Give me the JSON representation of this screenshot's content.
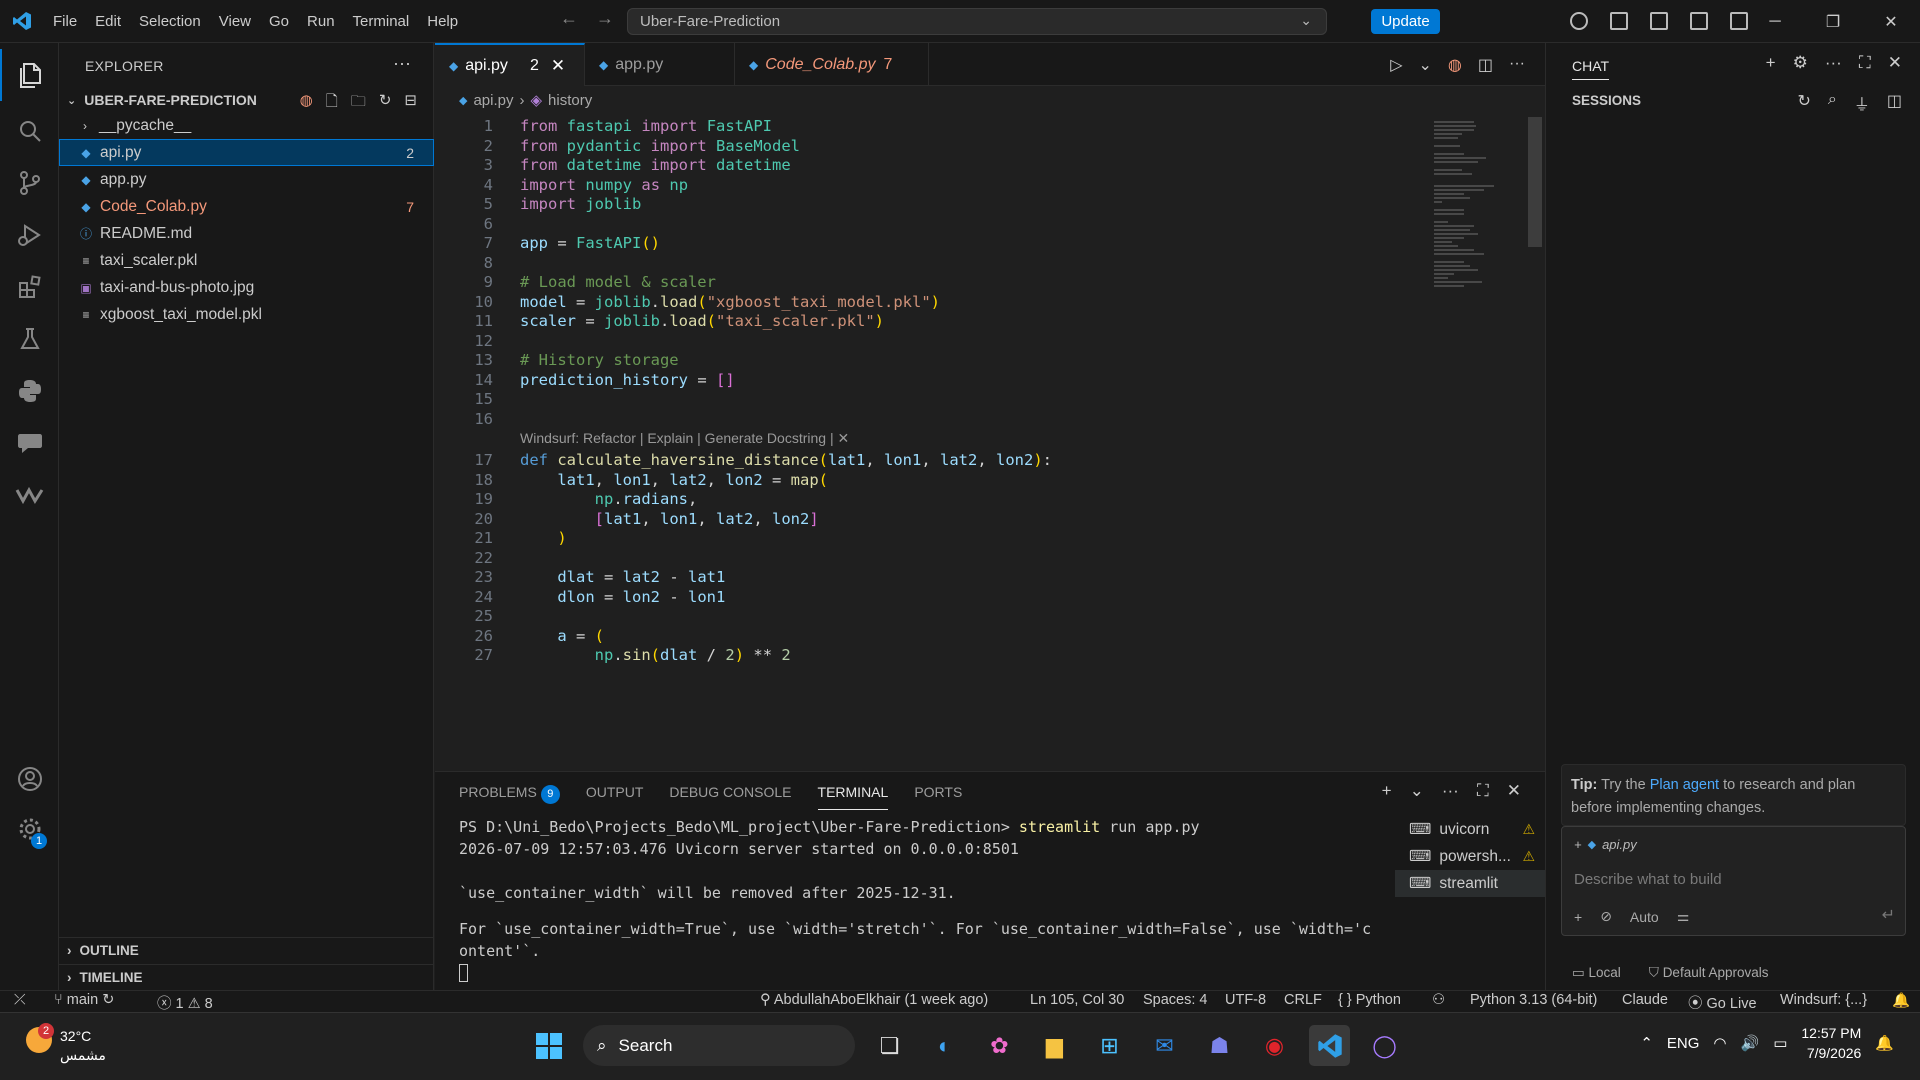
{
  "titlebar": {
    "menu": [
      "File",
      "Edit",
      "Selection",
      "View",
      "Go",
      "Run",
      "Terminal",
      "Help"
    ],
    "search_text": "Uber-Fare-Prediction",
    "update_label": "Update"
  },
  "explorer": {
    "title": "EXPLORER",
    "folder": "UBER-FARE-PREDICTION",
    "files": [
      {
        "name": "__pycache__",
        "type": "folder"
      },
      {
        "name": "api.py",
        "type": "python",
        "count": "2",
        "selected": true
      },
      {
        "name": "app.py",
        "type": "python"
      },
      {
        "name": "Code_Colab.py",
        "type": "python",
        "count": "7",
        "error": true
      },
      {
        "name": "README.md",
        "type": "info"
      },
      {
        "name": "taxi_scaler.pkl",
        "type": "file"
      },
      {
        "name": "taxi-and-bus-photo.jpg",
        "type": "image"
      },
      {
        "name": "xgboost_taxi_model.pkl",
        "type": "file"
      }
    ],
    "outline": "OUTLINE",
    "timeline": "TIMELINE"
  },
  "tabs": [
    {
      "label": "api.py",
      "count": "2",
      "active": true
    },
    {
      "label": "app.py",
      "count": ""
    },
    {
      "label": "Code_Colab.py",
      "count": "7",
      "error": true
    }
  ],
  "breadcrumb": {
    "file": "api.py",
    "symbol": "history"
  },
  "codelens": "Windsurf: Refactor | Explain | Generate Docstring | ✕",
  "code_lines": [
    {
      "n": "1",
      "html": "<span class='k'>from</span> fastapi <span class='k'>import</span> FastAPI"
    },
    {
      "n": "2",
      "html": "<span class='k'>from</span> pydantic <span class='k'>import</span> BaseModel"
    },
    {
      "n": "3",
      "html": "<span class='k'>from</span> datetime <span class='k'>import</span> datetime"
    },
    {
      "n": "4",
      "html": "<span class='k'>import</span> numpy <span class='k'>as</span> np"
    },
    {
      "n": "5",
      "html": "<span class='k'>import</span> joblib"
    },
    {
      "n": "6",
      "html": ""
    },
    {
      "n": "7",
      "html": "app = FastAPI()"
    },
    {
      "n": "8",
      "html": ""
    },
    {
      "n": "9",
      "html": "# Load model &amp; scaler"
    },
    {
      "n": "10",
      "html": "model = joblib.load(\"xgboost_taxi_model.pkl\")"
    },
    {
      "n": "11",
      "html": "scaler = joblib.load(\"taxi_scaler.pkl\")"
    },
    {
      "n": "12",
      "html": ""
    },
    {
      "n": "13",
      "html": "# History storage"
    },
    {
      "n": "14",
      "html": "prediction_history = []"
    },
    {
      "n": "15",
      "html": ""
    },
    {
      "n": "16",
      "html": ""
    },
    {
      "n": "17",
      "html": "def calculate_haversine_distance(lat1, lon1, lat2, lon2):"
    },
    {
      "n": "18",
      "html": "    lat1, lon1, lat2, lon2 = map("
    },
    {
      "n": "19",
      "html": "        np.radians,"
    },
    {
      "n": "20",
      "html": "        [lat1, lon1, lat2, lon2]"
    },
    {
      "n": "21",
      "html": "    )"
    },
    {
      "n": "22",
      "html": ""
    },
    {
      "n": "23",
      "html": "    dlat = lat2 - lat1"
    },
    {
      "n": "24",
      "html": "    dlon = lon2 - lon1"
    },
    {
      "n": "25",
      "html": ""
    },
    {
      "n": "26",
      "html": "    a = ("
    },
    {
      "n": "27",
      "html": "        np.sin(dlat / 2) ** 2"
    }
  ],
  "panel": {
    "tabs": [
      "PROBLEMS",
      "OUTPUT",
      "DEBUG CONSOLE",
      "TERMINAL",
      "PORTS"
    ],
    "problems_count": "9",
    "terminal_lines": [
      "PS D:\\Uni_Bedo\\Projects_Bedo\\ML_project\\Uber-Fare-Prediction> streamlit run app.py",
      "2026-07-09 12:57:03.476 Uvicorn server started on 0.0.0.0:8501",
      "",
      "`use_container_width` will be removed after 2025-12-31.",
      "",
      "For `use_container_width=True`, use `width='stretch'`. For `use_container_width=False`, use `width='c",
      "ontent'`."
    ],
    "terminals": [
      {
        "label": "uvicorn",
        "warn": true
      },
      {
        "label": "powersh...",
        "warn": true
      },
      {
        "label": "streamlit",
        "active": true
      }
    ]
  },
  "chat": {
    "title": "CHAT",
    "sessions": "SESSIONS",
    "tip_label": "Tip:",
    "tip_pre": " Try the ",
    "tip_link": "Plan agent",
    "tip_post": " to research and plan before implementing changes.",
    "context_file": "api.py",
    "placeholder": "Describe what to build",
    "mode": "Auto",
    "local": "Local",
    "approvals": "Default Approvals"
  },
  "statusbar": {
    "branch": "main",
    "errors": "1",
    "warnings": "8",
    "blame": "AbdullahAboElkhair (1 week ago)",
    "position": "Ln 105, Col 30",
    "spaces": "Spaces: 4",
    "encoding": "UTF-8",
    "eol": "CRLF",
    "language": "Python",
    "interpreter": "Python 3.13 (64-bit)",
    "claude": "Claude",
    "golive": "Go Live",
    "windsurf": "Windsurf: {...}"
  },
  "taskbar": {
    "temp": "32°C",
    "weather": "مشمس",
    "weather_badge": "2",
    "search": "Search",
    "lang": "ENG",
    "time": "12:57 PM",
    "date": "7/9/2026"
  }
}
